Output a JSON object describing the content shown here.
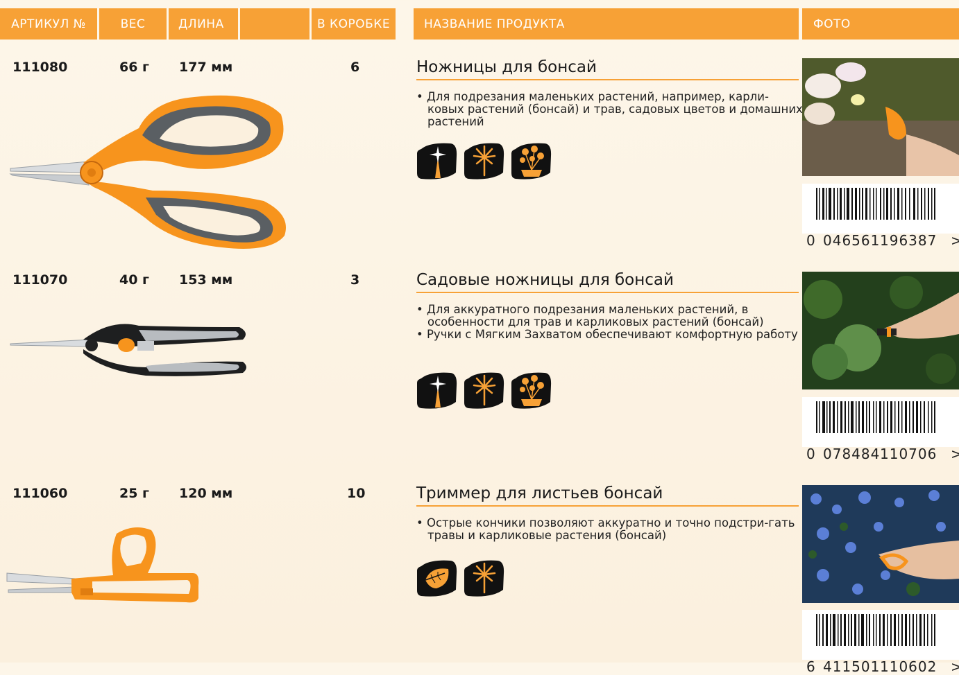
{
  "header": {
    "article": "АРТИКУЛ №",
    "weight": "ВЕС",
    "length": "ДЛИНА",
    "box": "В КОРОБКЕ",
    "name": "НАЗВАНИЕ ПРОДУКТА",
    "photo": "ФОТО"
  },
  "colors": {
    "accent": "#f7a136",
    "icon_bg": "#111111",
    "icon_fg": "#f7a136"
  },
  "products": [
    {
      "article": "111080",
      "weight": "66 г",
      "length": "177 мм",
      "box": "6",
      "title": "Ножницы для бонсай",
      "bullets": [
        "Для подрезания маленьких растений, например, карли-ковых растений (бонсай) и трав, садовых цветов и домашних растений"
      ],
      "icons": [
        "precision-icon",
        "flower-icon",
        "potted-plant-icon"
      ],
      "barcode": {
        "first": "0",
        "left": "046561",
        "right": "196387",
        "end": ">"
      }
    },
    {
      "article": "111070",
      "weight": "40 г",
      "length": "153 мм",
      "box": "3",
      "title": "Садовые ножницы для бонсай",
      "bullets": [
        "Для аккуратного подрезания маленьких растений, в особенности для трав и карликовых растений (бонсай)",
        "Ручки с Мягким Захватом обеспечивают комфортную работу"
      ],
      "icons": [
        "precision-icon",
        "flower-icon",
        "potted-plant-icon"
      ],
      "barcode": {
        "first": "0",
        "left": "078484",
        "right": "110706",
        "end": ">"
      }
    },
    {
      "article": "111060",
      "weight": "25 г",
      "length": "120 мм",
      "box": "10",
      "title": "Триммер для листьев бонсай",
      "bullets": [
        "Острые кончики позволяют аккуратно и точно подстри-гать травы и карликовые растения (бонсай)"
      ],
      "icons": [
        "leaf-icon",
        "flower-icon"
      ],
      "barcode": {
        "first": "6",
        "left": "411501",
        "right": "110602",
        "end": ">"
      }
    }
  ]
}
